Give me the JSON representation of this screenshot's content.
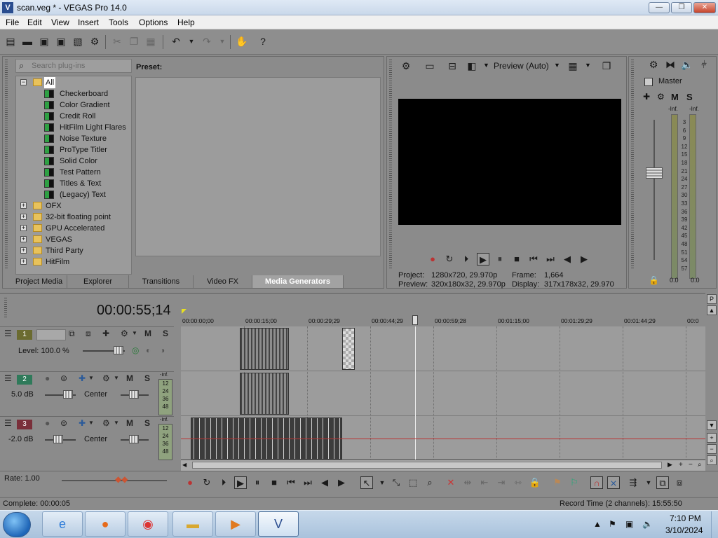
{
  "window": {
    "title": "scan.veg * - VEGAS Pro 14.0",
    "app_icon": "vegas-logo-icon",
    "minimize": "—",
    "maximize": "❐",
    "close": "✕"
  },
  "menu": [
    "File",
    "Edit",
    "View",
    "Insert",
    "Tools",
    "Options",
    "Help"
  ],
  "plugins": {
    "search_placeholder": "Search plug-ins",
    "preset_label": "Preset:",
    "tree": [
      {
        "label": "All",
        "level": 0,
        "expanded": true,
        "selected": true
      },
      {
        "label": "Checkerboard",
        "level": 1
      },
      {
        "label": "Color Gradient",
        "level": 1
      },
      {
        "label": "Credit Roll",
        "level": 1
      },
      {
        "label": "HitFilm Light Flares",
        "level": 1
      },
      {
        "label": "Noise Texture",
        "level": 1
      },
      {
        "label": "ProType Titler",
        "level": 1
      },
      {
        "label": "Solid Color",
        "level": 1
      },
      {
        "label": "Test Pattern",
        "level": 1
      },
      {
        "label": "Titles & Text",
        "level": 1
      },
      {
        "label": "(Legacy) Text",
        "level": 1
      },
      {
        "label": "OFX",
        "level": 0
      },
      {
        "label": "32-bit floating point",
        "level": 0
      },
      {
        "label": "GPU Accelerated",
        "level": 0
      },
      {
        "label": "VEGAS",
        "level": 0
      },
      {
        "label": "Third Party",
        "level": 0
      },
      {
        "label": "HitFilm",
        "level": 0
      }
    ],
    "tabs": [
      "Project Media",
      "Explorer",
      "Transitions",
      "Video FX",
      "Media Generators"
    ],
    "active_tab": "Media Generators"
  },
  "preview": {
    "mode_label": "Preview (Auto)",
    "project_label": "Project:",
    "project_value": "1280x720, 29.970p",
    "frame_label": "Frame:",
    "frame_value": "1,664",
    "preview_label": "Preview:",
    "preview_value": "320x180x32, 29.970p",
    "display_label": "Display:",
    "display_value": "317x178x32, 29.970"
  },
  "mixer": {
    "master_label": "Master",
    "m_label": "M",
    "s_label": "S",
    "inf_left": "-Inf.",
    "inf_right": "-Inf.",
    "scale": [
      "3",
      "6",
      "9",
      "12",
      "15",
      "18",
      "21",
      "24",
      "27",
      "30",
      "33",
      "36",
      "39",
      "42",
      "45",
      "48",
      "51",
      "54",
      "57"
    ],
    "bottom_left": "0.0",
    "bottom_right": "0.0"
  },
  "timeline": {
    "timecode": "00:00:55;14",
    "ruler": [
      "00:00:00;00",
      "00:00:15;00",
      "00:00:29;29",
      "00:00:44;29",
      "00:00:59;28",
      "00:01:15;00",
      "00:01:29;29",
      "00:01:44;29",
      "00:0"
    ],
    "tracks": [
      {
        "number": "1",
        "type": "video",
        "level_label": "Level: 100.0 %"
      },
      {
        "number": "2",
        "type": "audio",
        "volume": "5.0 dB",
        "pan": "Center"
      },
      {
        "number": "3",
        "type": "audio",
        "volume": "-2.0 dB",
        "pan": "Center"
      }
    ],
    "m_label": "M",
    "s_label": "S",
    "meter_inf": "-Inf.",
    "meter_marks": [
      "12",
      "24",
      "36",
      "48"
    ]
  },
  "transport": {
    "rate_label": "Rate: 1.00"
  },
  "status": {
    "left": "Complete: 00:00:05",
    "right": "Record Time (2 channels): 15:55:50"
  },
  "taskbar": {
    "time": "7:10 PM",
    "date": "3/10/2024"
  }
}
